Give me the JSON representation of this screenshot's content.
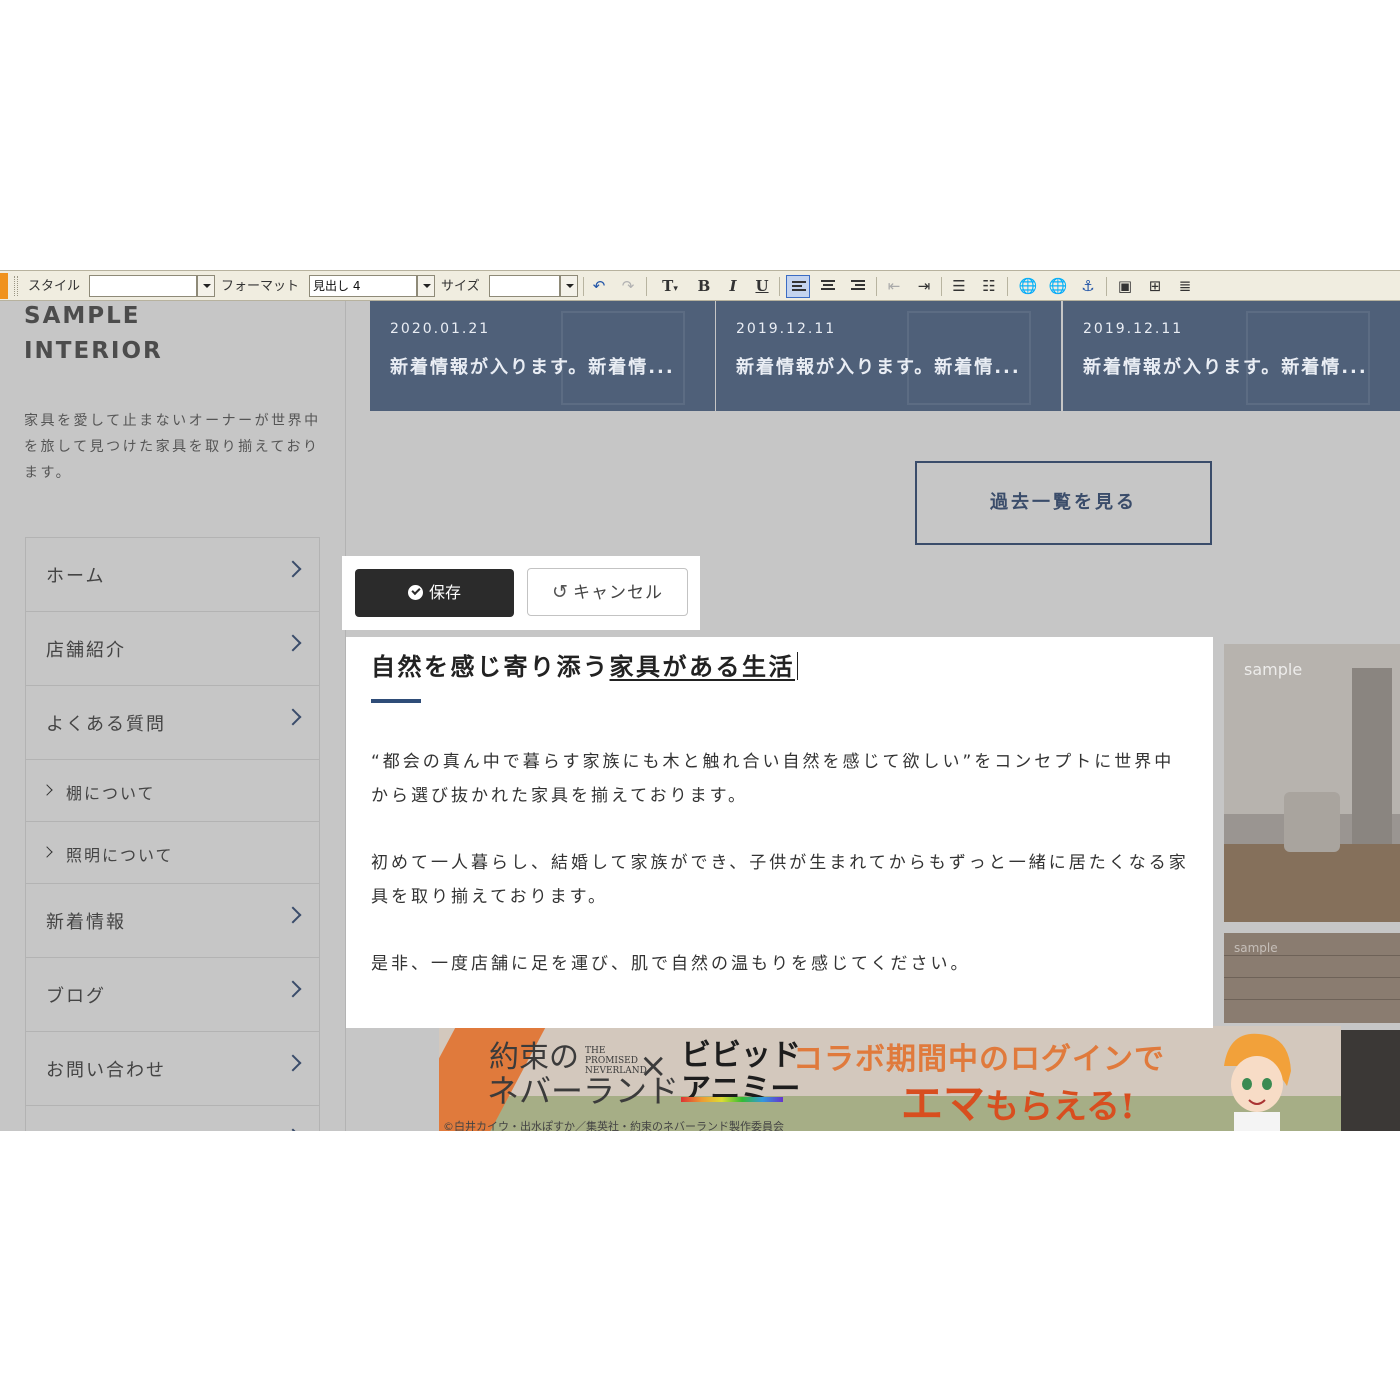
{
  "toolbar": {
    "style_label": "スタイル",
    "style_value": "",
    "format_label": "フォーマット",
    "format_value": "見出し 4",
    "size_label": "サイズ",
    "size_value": ""
  },
  "sidebar": {
    "logo_line1": "SAMPLE",
    "logo_line2": "INTERIOR",
    "tagline": "家具を愛して止まないオーナーが世界中を旅して見つけた家具を取り揃えております。",
    "nav": {
      "home": "ホーム",
      "shop": "店舗紹介",
      "faq": "よくある質問",
      "faq_shelf": "棚について",
      "faq_light": "照明について",
      "news": "新着情報",
      "blog": "ブログ",
      "contact": "お問い合わせ"
    }
  },
  "news_cards": [
    {
      "date": "2020.01.21",
      "title": "新着情報が入ります。新着情..."
    },
    {
      "date": "2019.12.11",
      "title": "新着情報が入ります。新着情..."
    },
    {
      "date": "2019.12.11",
      "title": "新着情報が入ります。新着情..."
    }
  ],
  "past_button": "過去一覧を見る",
  "editor": {
    "save_label": "保存",
    "cancel_label": "キャンセル",
    "heading_plain": "自然を感じ寄り添う",
    "heading_underlined": "家具がある生活",
    "paragraphs": [
      "“都会の真ん中で暮らす家族にも木と触れ合い自然を感じて欲しい”をコンセプトに世界中から選び抜かれた家具を揃えております。",
      "初めて一人暮らし、結婚して家族ができ、子供が生まれてからもずっと一緒に居たくなる家具を取り揃えております。",
      "是非、一度店舗に足を運び、肌で自然の温もりを感じてください。"
    ]
  },
  "photos": {
    "label1": "sample",
    "label2": "sample"
  },
  "banner": {
    "neverland_line1": "約束の",
    "neverland_line2": "ネバーランド",
    "neverland_en": "THE PROMISED NEVERLAND",
    "cross": "×",
    "vivid_line1": "ビビッド",
    "vivid_line2": "アニミー",
    "collab_text": "コラボ期間中のログインで",
    "get_text_big": "エマ",
    "get_text_small": "もらえる!",
    "credit": "©白井カイウ・出水ぽすか／集英社・約束のネバーランド製作委員会"
  },
  "colors": {
    "navy": "#3a4c6a",
    "news_card_bg": "#4f6079",
    "heading_bar": "#2f4d78",
    "banner_accent": "#e07a3c"
  }
}
